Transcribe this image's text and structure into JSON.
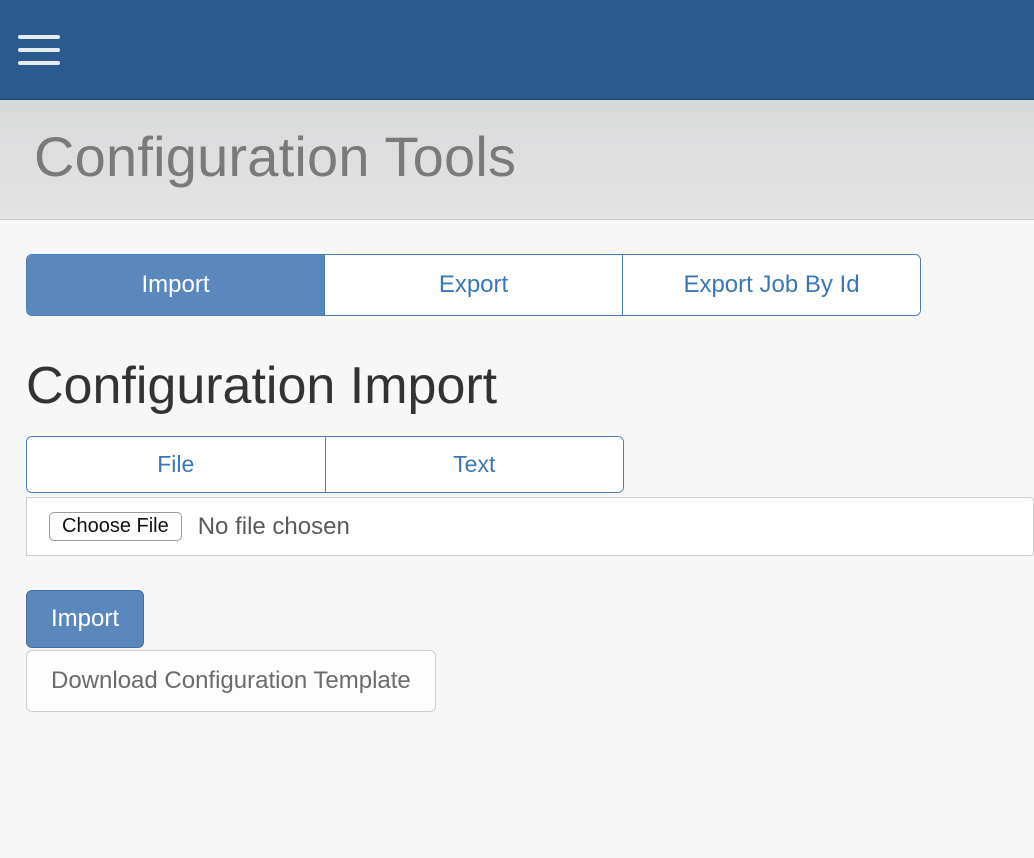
{
  "header": {
    "title": "Configuration Tools"
  },
  "tabs": {
    "items": [
      {
        "label": "Import",
        "active": true
      },
      {
        "label": "Export",
        "active": false
      },
      {
        "label": "Export Job By Id",
        "active": false
      }
    ]
  },
  "section": {
    "title": "Configuration Import"
  },
  "subtabs": {
    "items": [
      {
        "label": "File"
      },
      {
        "label": "Text"
      }
    ]
  },
  "fileInput": {
    "buttonLabel": "Choose File",
    "status": "No file chosen"
  },
  "actions": {
    "importLabel": "Import",
    "downloadTemplateLabel": "Download Configuration Template"
  }
}
